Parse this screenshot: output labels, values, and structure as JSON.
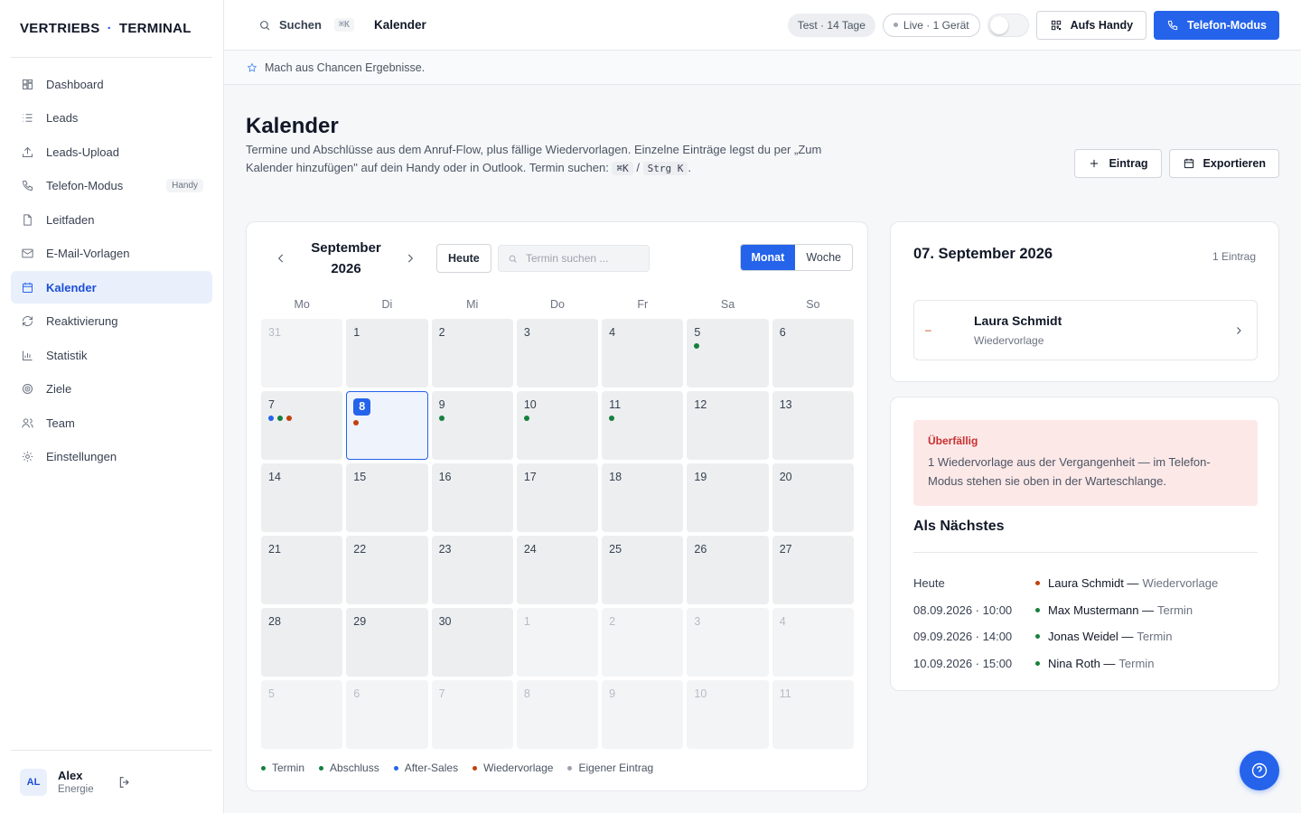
{
  "brand": {
    "left": "VERTRIEBS",
    "sep": "·",
    "right": "TERMINAL"
  },
  "nav": [
    {
      "label": "Dashboard",
      "icon": "dashboard-icon"
    },
    {
      "label": "Leads",
      "icon": "list-icon"
    },
    {
      "label": "Leads-Upload",
      "icon": "upload-icon"
    },
    {
      "label": "Telefon-Modus",
      "icon": "phone-icon",
      "badge": "Handy"
    },
    {
      "label": "Leitfaden",
      "icon": "document-icon"
    },
    {
      "label": "E-Mail-Vorlagen",
      "icon": "mail-icon"
    },
    {
      "label": "Kalender",
      "icon": "calendar-icon",
      "active": true
    },
    {
      "label": "Reaktivierung",
      "icon": "refresh-icon"
    },
    {
      "label": "Statistik",
      "icon": "bar-chart-icon"
    },
    {
      "label": "Ziele",
      "icon": "target-icon"
    },
    {
      "label": "Team",
      "icon": "users-icon"
    },
    {
      "label": "Einstellungen",
      "icon": "gear-icon"
    }
  ],
  "user": {
    "initials": "AL",
    "name": "Alex",
    "org": "Energie"
  },
  "topbar": {
    "search_label": "Suchen",
    "search_kbd": "⌘K",
    "title": "Kalender",
    "trial": "Test · 14 Tage",
    "live": "Live · 1 Gerät",
    "handy_btn": "Aufs Handy",
    "phone_btn": "Telefon-Modus"
  },
  "strip": {
    "text": "Mach aus Chancen Ergebnisse."
  },
  "page": {
    "title": "Kalender",
    "desc_1": "Termine und Abschlüsse aus dem Anruf-Flow, plus fällige Wiedervorlagen. Einzelne Einträge legst du per „Zum Kalender hinzufügen\" auf dein Handy oder in Outlook. Termin suchen:",
    "kbd_1": "⌘K",
    "slash": "/",
    "kbd_2": "Strg K",
    "end": ".",
    "add_btn": "Eintrag",
    "export_btn": "Exportieren"
  },
  "calendar": {
    "month": "September 2026",
    "today_btn": "Heute",
    "search_placeholder": "Termin suchen ...",
    "view_month": "Monat",
    "view_week": "Woche",
    "weekdays": [
      "Mo",
      "Di",
      "Mi",
      "Do",
      "Fr",
      "Sa",
      "So"
    ],
    "days": [
      {
        "d": "31",
        "other": true
      },
      {
        "d": "1"
      },
      {
        "d": "2"
      },
      {
        "d": "3"
      },
      {
        "d": "4"
      },
      {
        "d": "5",
        "dots": [
          "#15803d"
        ]
      },
      {
        "d": "6"
      },
      {
        "d": "7",
        "dots": [
          "#2563eb",
          "#15803d",
          "#c2410c"
        ]
      },
      {
        "d": "8",
        "selected": true,
        "dots": [
          "#c2410c"
        ]
      },
      {
        "d": "9",
        "dots": [
          "#15803d"
        ]
      },
      {
        "d": "10",
        "dots": [
          "#15803d"
        ]
      },
      {
        "d": "11",
        "dots": [
          "#15803d"
        ]
      },
      {
        "d": "12"
      },
      {
        "d": "13"
      },
      {
        "d": "14"
      },
      {
        "d": "15"
      },
      {
        "d": "16"
      },
      {
        "d": "17"
      },
      {
        "d": "18"
      },
      {
        "d": "19"
      },
      {
        "d": "20"
      },
      {
        "d": "21"
      },
      {
        "d": "22"
      },
      {
        "d": "23"
      },
      {
        "d": "24"
      },
      {
        "d": "25"
      },
      {
        "d": "26"
      },
      {
        "d": "27"
      },
      {
        "d": "28"
      },
      {
        "d": "29"
      },
      {
        "d": "30"
      },
      {
        "d": "1",
        "other": true
      },
      {
        "d": "2",
        "other": true
      },
      {
        "d": "3",
        "other": true
      },
      {
        "d": "4",
        "other": true
      },
      {
        "d": "5",
        "other": true
      },
      {
        "d": "6",
        "other": true
      },
      {
        "d": "7",
        "other": true
      },
      {
        "d": "8",
        "other": true
      },
      {
        "d": "9",
        "other": true
      },
      {
        "d": "10",
        "other": true
      },
      {
        "d": "11",
        "other": true
      }
    ],
    "legend": [
      {
        "label": "Termin",
        "color": "#15803d"
      },
      {
        "label": "Abschluss",
        "color": "#15803d"
      },
      {
        "label": "After-Sales",
        "color": "#2563eb"
      },
      {
        "label": "Wiedervorlage",
        "color": "#c2410c"
      },
      {
        "label": "Eigener Eintrag",
        "color": "#9ca3af"
      }
    ]
  },
  "day_panel": {
    "title": "07. September 2026",
    "count": "1 Eintrag",
    "entry_dash": "–",
    "entry_name": "Laura Schmidt",
    "entry_type": "Wiedervorlage"
  },
  "next_panel": {
    "alert_title": "Überfällig",
    "alert_text": "1 Wiedervorlage aus der Vergangenheit — im Telefon-Modus stehen sie oben in der Warteschlange.",
    "title": "Als Nächstes",
    "items": [
      {
        "when": "Heute",
        "color": "#c2410c",
        "who": "Laura Schmidt —",
        "kind": "Wiedervorlage"
      },
      {
        "when": "08.09.2026 · 10:00",
        "color": "#15803d",
        "who": "Max Mustermann —",
        "kind": "Termin"
      },
      {
        "when": "09.09.2026 · 14:00",
        "color": "#15803d",
        "who": "Jonas Weidel —",
        "kind": "Termin"
      },
      {
        "when": "10.09.2026 · 15:00",
        "color": "#15803d",
        "who": "Nina Roth —",
        "kind": "Termin"
      }
    ]
  }
}
